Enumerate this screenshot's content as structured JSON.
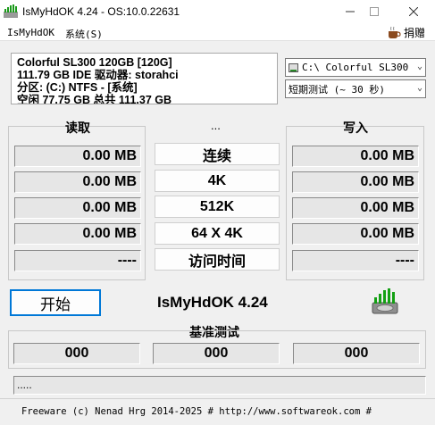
{
  "window": {
    "title": "IsMyHdOK 4.24 - OS:10.0.22631",
    "min_icon": "minimize-icon",
    "max_icon": "maximize-icon",
    "close_icon": "close-icon"
  },
  "menu": {
    "items": [
      "IsMyHdOK",
      "系统(S)"
    ],
    "donate_label": "捐赠"
  },
  "disk_info": {
    "lines": [
      "Colorful SL300 120GB [120G]",
      "111.79 GB  IDE 驱动器: storahci",
      "分区: (C:) NTFS - [系统]",
      "空闲 77.75 GB 总共 111.37 GB"
    ]
  },
  "drive_select": {
    "value": "C:\\ Colorful SL300"
  },
  "test_select": {
    "value": "短期测试 (~ 30 秒)"
  },
  "read": {
    "title": "读取",
    "values": [
      "0.00 MB",
      "0.00 MB",
      "0.00 MB",
      "0.00 MB",
      "----"
    ]
  },
  "middle": {
    "title": "...",
    "buttons": [
      "连续",
      "4K",
      "512K",
      "64 X 4K",
      "访问时间"
    ]
  },
  "write": {
    "title": "写入",
    "values": [
      "0.00 MB",
      "0.00 MB",
      "0.00 MB",
      "0.00 MB",
      "----"
    ]
  },
  "start_label": "开始",
  "product_name": "IsMyHdOK 4.24",
  "benchmark": {
    "title": "基准测试",
    "values": [
      "000",
      "000",
      "000"
    ]
  },
  "status_text": ".....",
  "footer": "Freeware (c) Nenad Hrg 2014-2025 # http://www.softwareok.com   #"
}
